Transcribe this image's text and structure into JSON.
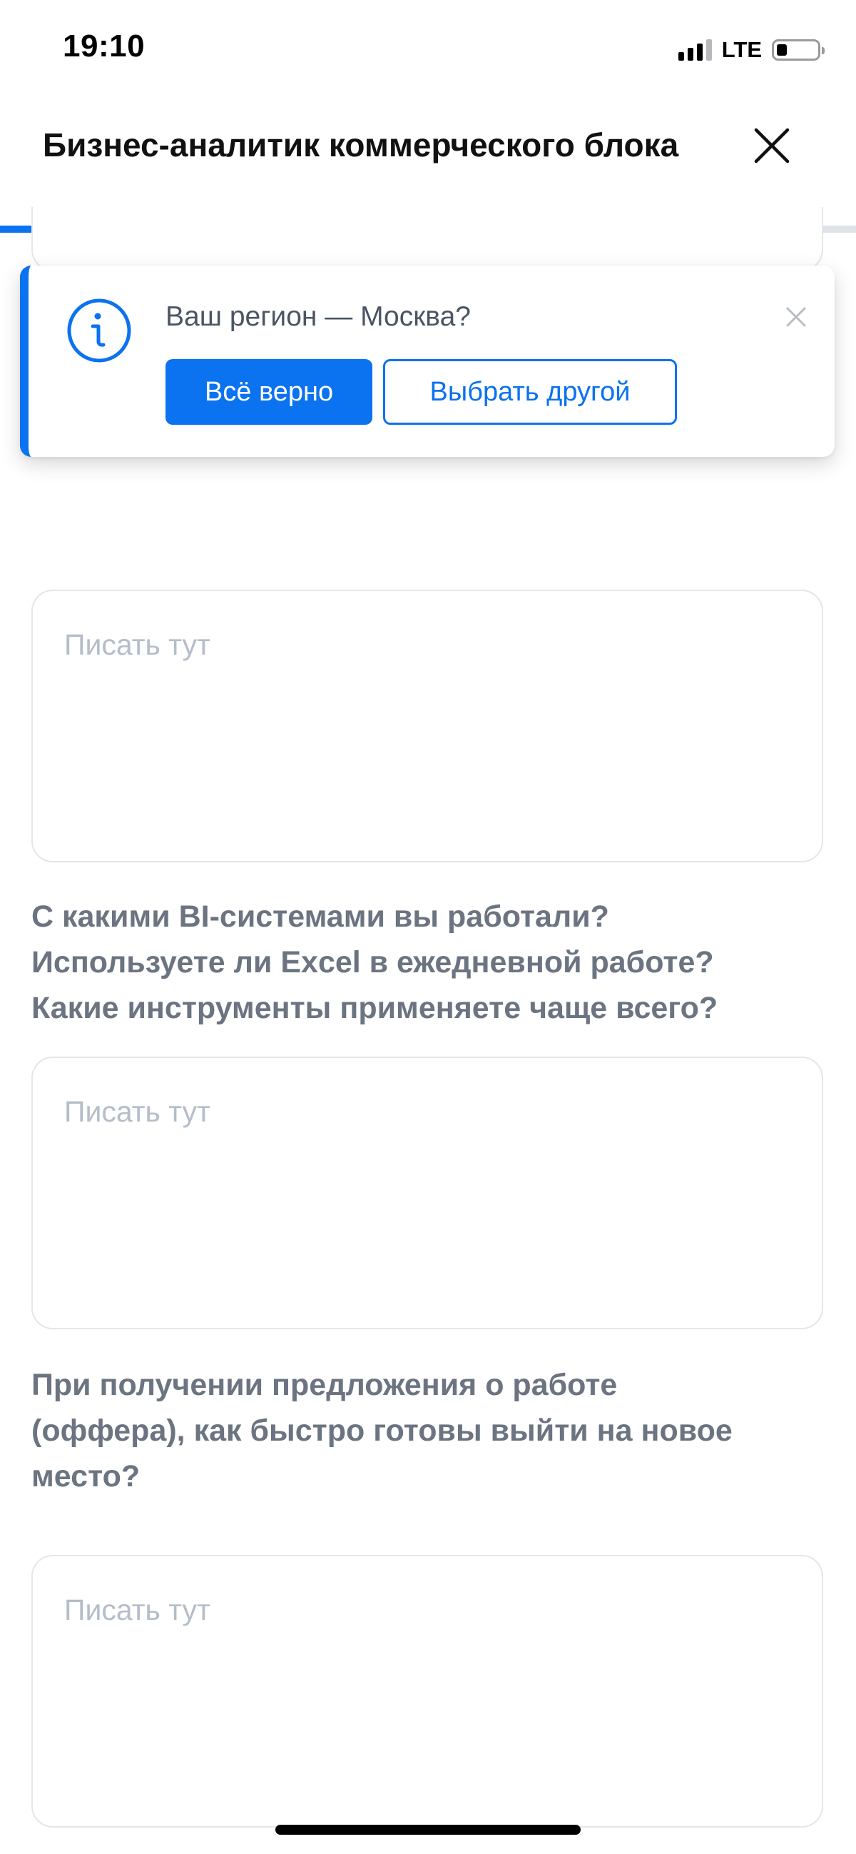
{
  "status_bar": {
    "time": "19:10",
    "network": "LTE",
    "battery_level": 0.25,
    "signal_bars_active": 3,
    "signal_bars_total": 4
  },
  "header": {
    "title": "Бизнес-аналитик коммерческого блока",
    "close_icon": "close-icon"
  },
  "progress": {
    "fraction": 0.9
  },
  "region_prompt": {
    "icon": "info-icon",
    "question": "Ваш регион — Москва?",
    "confirm_label": "Всё верно",
    "choose_other_label": "Выбрать другой",
    "close_icon": "close-icon"
  },
  "form": {
    "answer_placeholder": "Писать тут",
    "questions": [
      {
        "lines": [
          "С какими BI-системами вы работали?",
          "Используете ли Excel в ежедневной работе?",
          "Какие инструменты применяете чаще всего?"
        ]
      },
      {
        "lines": [
          "При получении предложения о работе",
          "(оффера), как быстро готовы выйти на новое",
          "место?"
        ]
      }
    ]
  },
  "colors": {
    "accent": "#0b72f0",
    "question_text": "#6b7480",
    "placeholder_text": "#b4bdc9",
    "border": "#e3e6ea",
    "progress_track": "#dfe3e8"
  }
}
